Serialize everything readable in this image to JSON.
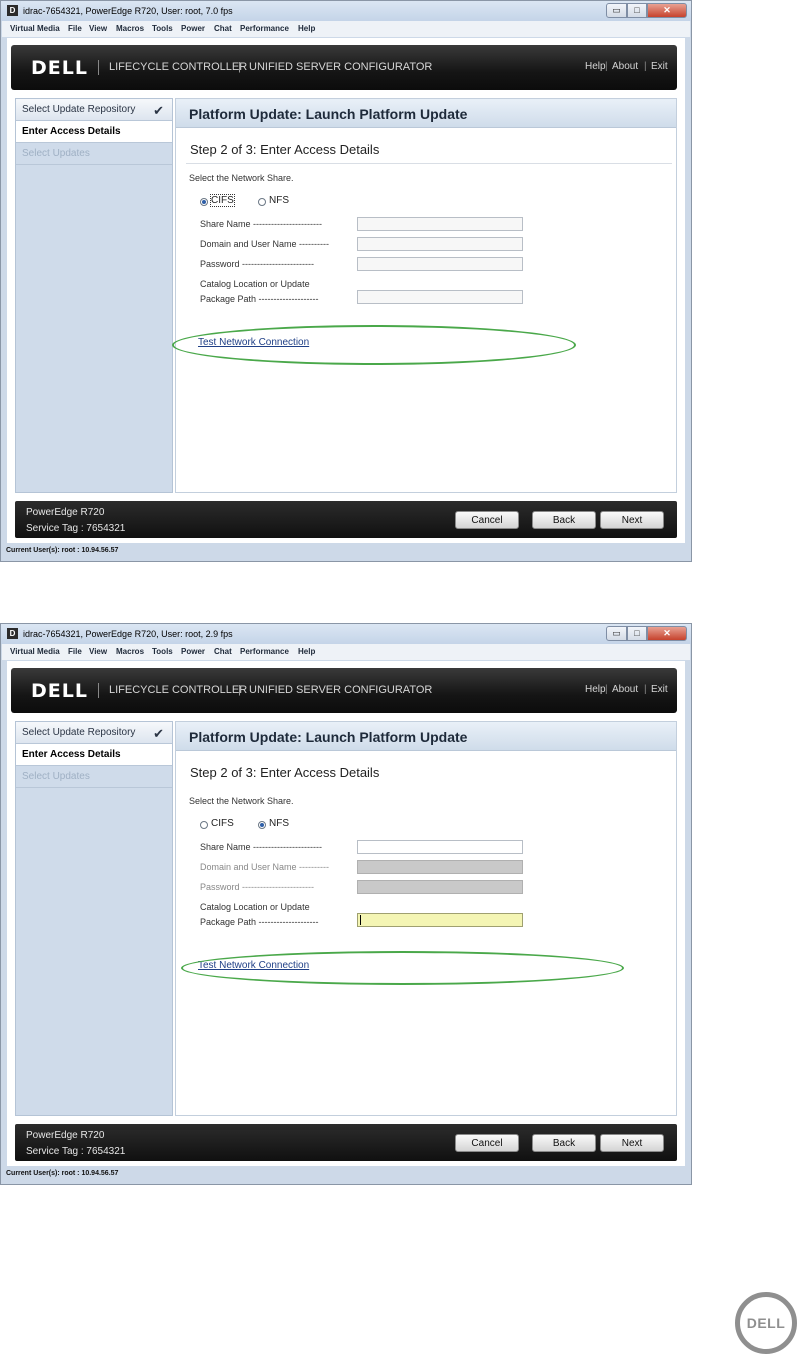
{
  "window1": {
    "title": "idrac-7654321, PowerEdge R720, User: root, 7.0 fps",
    "status": "Current User(s): root : 10.94.56.57"
  },
  "window2": {
    "title": "idrac-7654321, PowerEdge R720, User: root, 2.9 fps",
    "status": "Current User(s): root : 10.94.56.57"
  },
  "menu": [
    "Virtual Media",
    "File",
    "View",
    "Macros",
    "Tools",
    "Power",
    "Chat",
    "Performance",
    "Help"
  ],
  "window_controls": {
    "minimize": "▭",
    "maximize": "□",
    "close": "✕"
  },
  "header": {
    "logo": "DELL",
    "product": "LIFECYCLE CONTROLLER",
    "subtitle": "UNIFIED SERVER CONFIGURATOR",
    "links": [
      "Help",
      "About",
      "Exit"
    ],
    "sep": "|"
  },
  "sidebar": {
    "items": [
      "Select Update Repository",
      "Enter Access Details",
      "Select Updates"
    ],
    "check": "✔"
  },
  "page": {
    "title": "Platform Update: Launch Platform Update",
    "step": "Step 2 of 3: Enter Access Details",
    "share_prompt": "Select the Network Share.",
    "cifs": "CIFS",
    "nfs": "NFS",
    "fields": {
      "share_name": "Share Name -----------------------",
      "domain_user": "Domain and User Name ----------",
      "password": "Password ------------------------",
      "catalog_1": "Catalog Location or Update",
      "catalog_2": "Package Path --------------------"
    },
    "test_link": "Test Network Connection"
  },
  "footer": {
    "model": "PowerEdge R720",
    "service_tag": "Service Tag : 7654321",
    "cancel": "Cancel",
    "back": "Back",
    "next": "Next"
  },
  "selected_share": {
    "window1": "CIFS",
    "window2": "NFS"
  },
  "colors": {
    "accent_green": "#4aa84a",
    "link_blue": "#1f3f86",
    "field_highlight": "#f4f5b4"
  },
  "corner_logo": "DELL"
}
